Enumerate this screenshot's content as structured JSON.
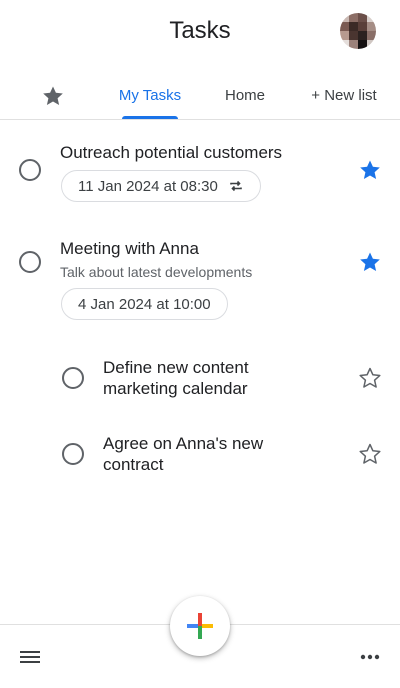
{
  "header": {
    "title": "Tasks",
    "avatar_icon": "user-avatar"
  },
  "tabs": [
    {
      "icon": "star-icon"
    },
    {
      "label": "My Tasks",
      "selected": true
    },
    {
      "label": "Home"
    },
    {
      "label": "+ New list"
    }
  ],
  "tasks": [
    {
      "title": "Outreach potential customers",
      "date": "11 Jan 2024 at 08:30",
      "repeat": true,
      "starred": true
    },
    {
      "title": "Meeting with Anna",
      "notes": "Talk about latest developments",
      "date": "4 Jan 2024 at 10:00",
      "starred": true,
      "subtasks": [
        {
          "title_line1": "Define new content",
          "title_line2": "marketing calendar",
          "starred": false
        },
        {
          "title_line1": "Agree on Anna's new",
          "title_line2": "contract",
          "starred": false
        }
      ]
    }
  ],
  "bottom_bar": {
    "menu_icon": "hamburger-menu-icon",
    "fab_icon": "plus-icon",
    "more_icon": "more-horizontal-icon"
  },
  "colors": {
    "accent": "#1a73e8",
    "star_filled": "#1a73e8",
    "text": "#202124",
    "secondary_text": "#5f6368"
  }
}
